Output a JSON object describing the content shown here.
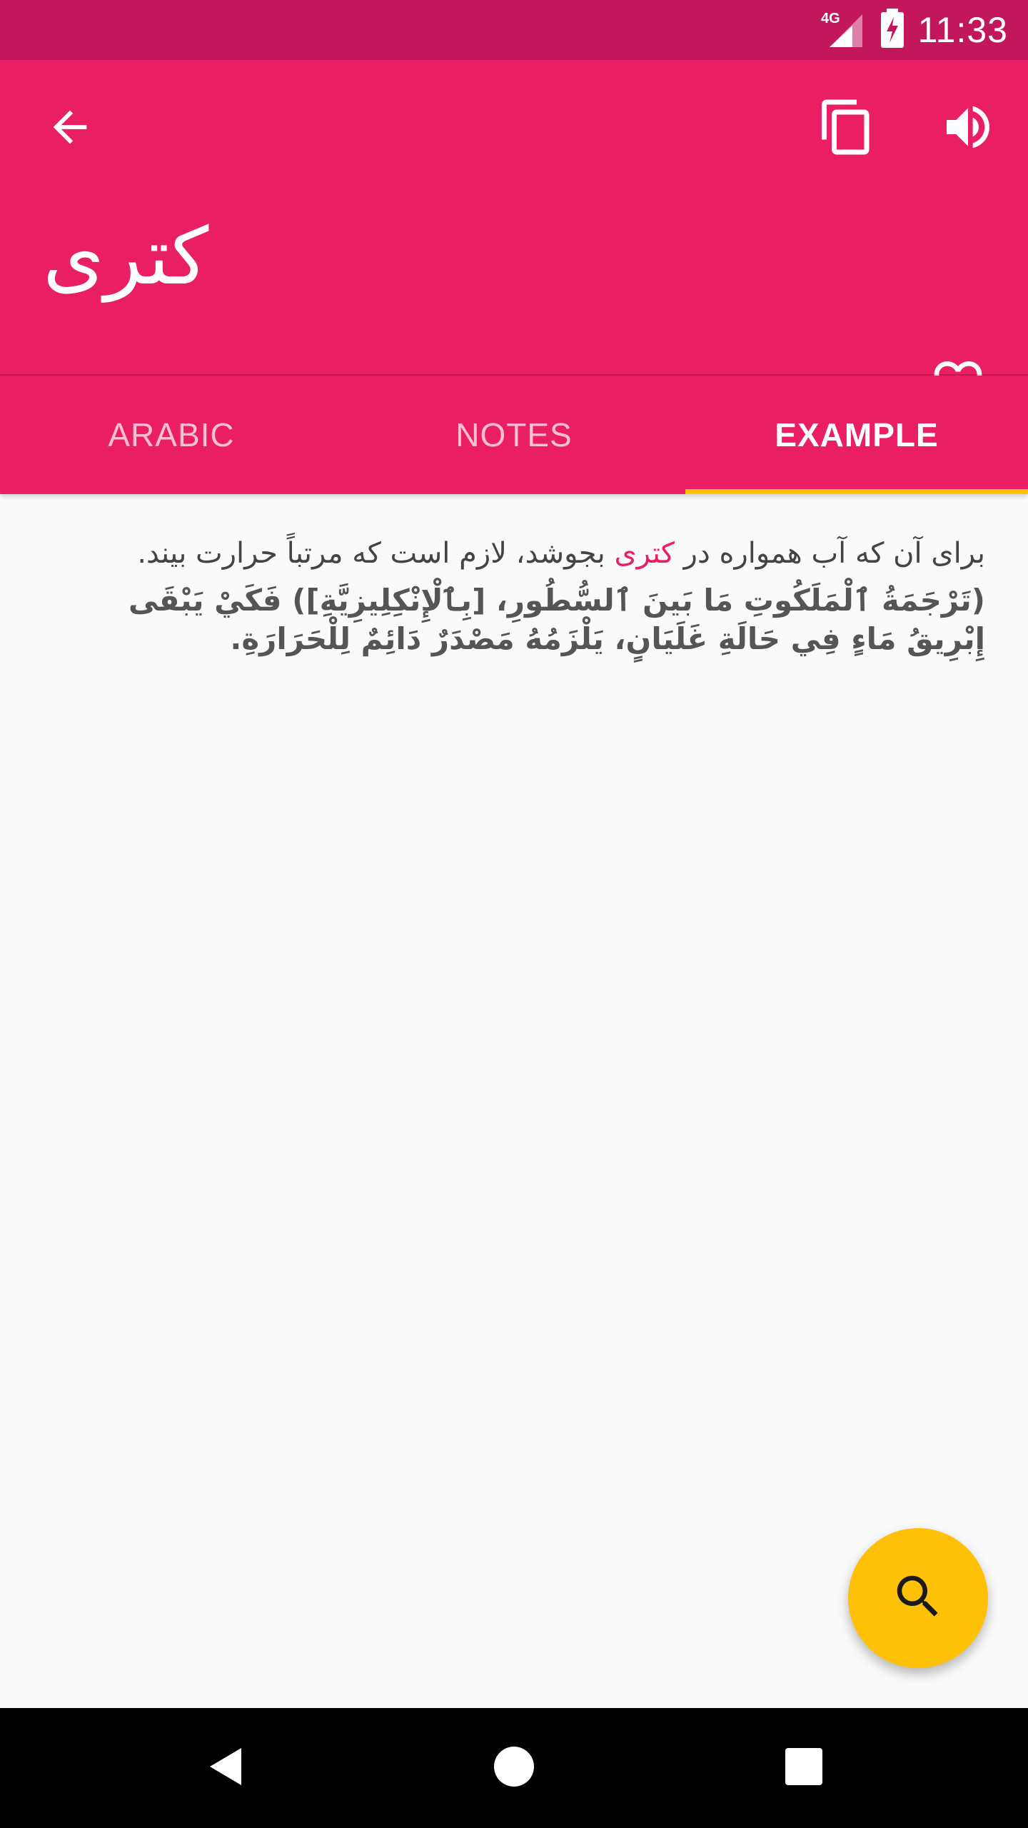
{
  "status_bar": {
    "network": "4G",
    "time": "11:33"
  },
  "app_bar": {
    "word": "کتری",
    "icons": {
      "back": "arrow-back-icon",
      "copy": "copy-icon",
      "speaker": "volume-up-icon",
      "favorite": "heart-outline-icon"
    }
  },
  "tabs": [
    {
      "label": "ARABIC",
      "active": false
    },
    {
      "label": "NOTES",
      "active": false
    },
    {
      "label": "EXAMPLE",
      "active": true
    }
  ],
  "example": {
    "persian_before": "برای آن که آب همواره در ",
    "persian_highlight": "کتری",
    "persian_after": " بجوشد، لازم است که مرتباً حرارت بیند.",
    "arabic": "(تَرْجَمَةُ ٱلْمَلَكُوتِ مَا بَينَ ٱلسُّطُورِ، [بِٱلْإِنْكِلِيزِيَّةِ]) فَكَيْ يَبْقَى إِبْرِيقُ مَاءٍ فِي حَالَةِ غَلَيَانٍ، يَلْزَمُهُ مَصْدَرٌ دَائِمٌ لِلْحَرَارَةِ."
  },
  "fab": {
    "icon": "search-icon"
  },
  "colors": {
    "status_bar": "#C2185B",
    "primary": "#E91E63",
    "accent": "#FFC107",
    "background": "#FAFAFA"
  }
}
